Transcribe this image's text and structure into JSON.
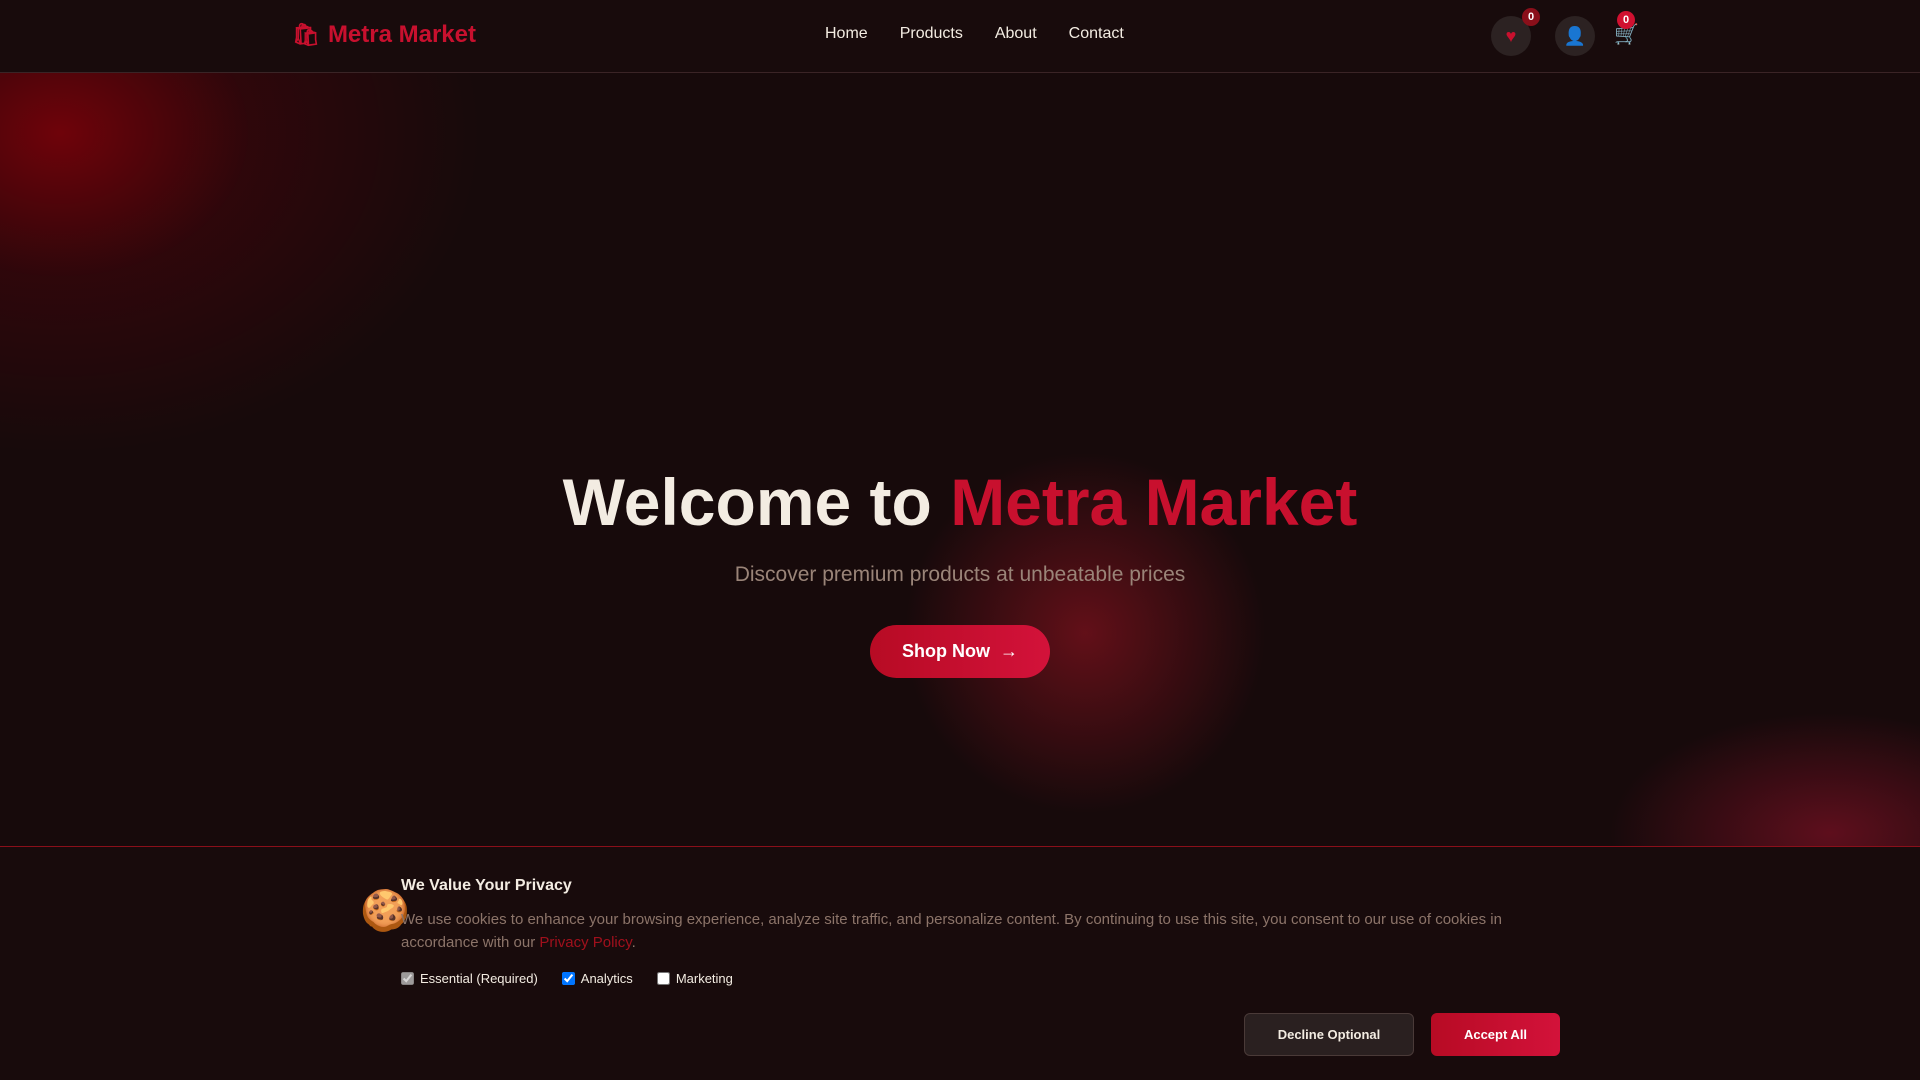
{
  "header": {
    "logo_icon": "🛍",
    "logo_text": "Metra Market",
    "nav": [
      "Home",
      "Products",
      "About",
      "Contact"
    ],
    "wishlist_icon": "♥",
    "wishlist_count": "0",
    "user_icon": "👤",
    "cart_icon": "🛒",
    "cart_count": "0"
  },
  "hero": {
    "title_prefix": "Welcome to ",
    "title_brand": "Metra Market",
    "subtitle": "Discover premium products at unbeatable prices",
    "cta_label": "Shop Now",
    "cta_icon": "→"
  },
  "cookie": {
    "icon": "🍪",
    "title": "We Value Your Privacy",
    "text": "We use cookies to enhance your browsing experience, analyze site traffic, and personalize content. By continuing to use this site, you consent to our use of cookies in accordance with our ",
    "policy_link": "Privacy Policy",
    "text_end": ".",
    "options": [
      {
        "label": "Essential (Required)",
        "checked": true,
        "disabled": true
      },
      {
        "label": "Analytics",
        "checked": true,
        "disabled": false
      },
      {
        "label": "Marketing",
        "checked": false,
        "disabled": false
      }
    ],
    "decline_label": "Decline Optional",
    "accept_label": "Accept All"
  },
  "colors": {
    "accent": "#c8102e",
    "background": "#160a0b",
    "text": "#f3ece2"
  }
}
